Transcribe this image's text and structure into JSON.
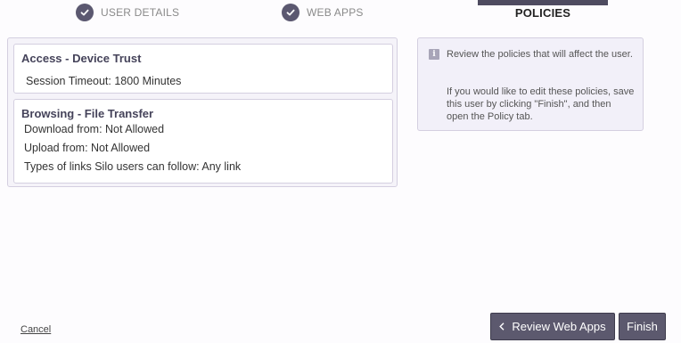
{
  "steps": [
    {
      "label": "USER DETAILS",
      "completed": true,
      "icon": "check-icon"
    },
    {
      "label": "WEB APPS",
      "completed": true,
      "icon": "check-icon"
    },
    {
      "label": "POLICIES",
      "active": true
    }
  ],
  "policies": {
    "access": {
      "title": "Access - Device Trust",
      "lines": [
        "Session Timeout: 1800 Minutes"
      ]
    },
    "browsing": {
      "title": "Browsing - File Transfer",
      "lines": [
        "Download from: Not Allowed",
        "Upload from: Not Allowed",
        "Types of links Silo users can follow: Any link"
      ]
    }
  },
  "info": {
    "icon": "info-icon",
    "paragraph1": "Review the policies that will affect the user.",
    "paragraph2": "If you would like to edit these policies, save this user by clicking \"Finish\", and then open the Policy tab."
  },
  "footer": {
    "cancel_label": "Cancel",
    "back_label": "Review Web Apps",
    "finish_label": "Finish"
  },
  "colors": {
    "accent": "#5c596e",
    "panel_bg": "#f5f3f9",
    "info_bg": "#f2f0f9",
    "border": "#d4cfe0"
  }
}
